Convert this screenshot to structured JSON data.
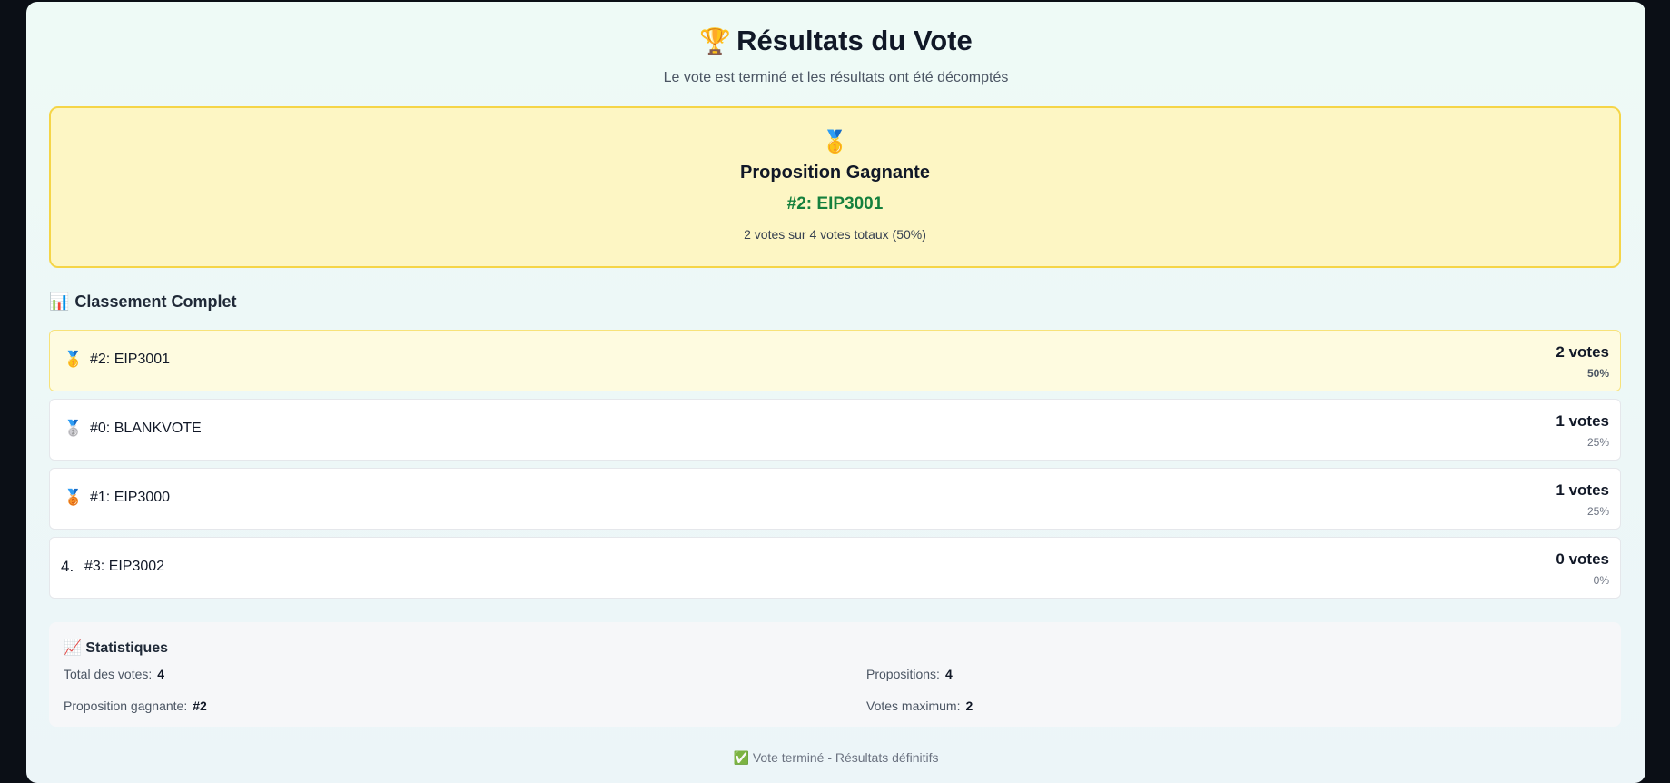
{
  "header": {
    "title_icon": "🏆",
    "title": "Résultats du Vote",
    "subtitle": "Le vote est terminé et les résultats ont été décomptés"
  },
  "winner": {
    "medal_icon": "🥇",
    "title": "Proposition Gagnante",
    "name": "#2: EIP3001",
    "stats": "2 votes sur 4 votes totaux  (50%)"
  },
  "ranking": {
    "title_icon": "📊",
    "title": "Classement Complet",
    "rows": [
      {
        "position": "🥇",
        "name": "#2: EIP3001",
        "votes": "2 votes",
        "percent": "50%"
      },
      {
        "position": "🥈",
        "name": "#0: BLANKVOTE",
        "votes": "1 votes",
        "percent": "25%"
      },
      {
        "position": "🥉",
        "name": "#1: EIP3000",
        "votes": "1 votes",
        "percent": "25%"
      },
      {
        "position": "4.",
        "name": "#3: EIP3002",
        "votes": "0 votes",
        "percent": "0%"
      }
    ]
  },
  "statistics": {
    "title_icon": "📈",
    "title": "Statistiques",
    "total_votes_label": "Total des votes:",
    "total_votes_value": "4",
    "proposals_label": "Propositions:",
    "proposals_value": "4",
    "winning_label": "Proposition gagnante:",
    "winning_value": "#2",
    "max_votes_label": "Votes maximum:",
    "max_votes_value": "2"
  },
  "footer": {
    "icon": "✅",
    "text": "Vote terminé - Résultats définitifs"
  },
  "colors": {
    "winner_bg": "#fdf6c4",
    "winner_border": "#f5d547",
    "winner_name": "#15803d"
  }
}
